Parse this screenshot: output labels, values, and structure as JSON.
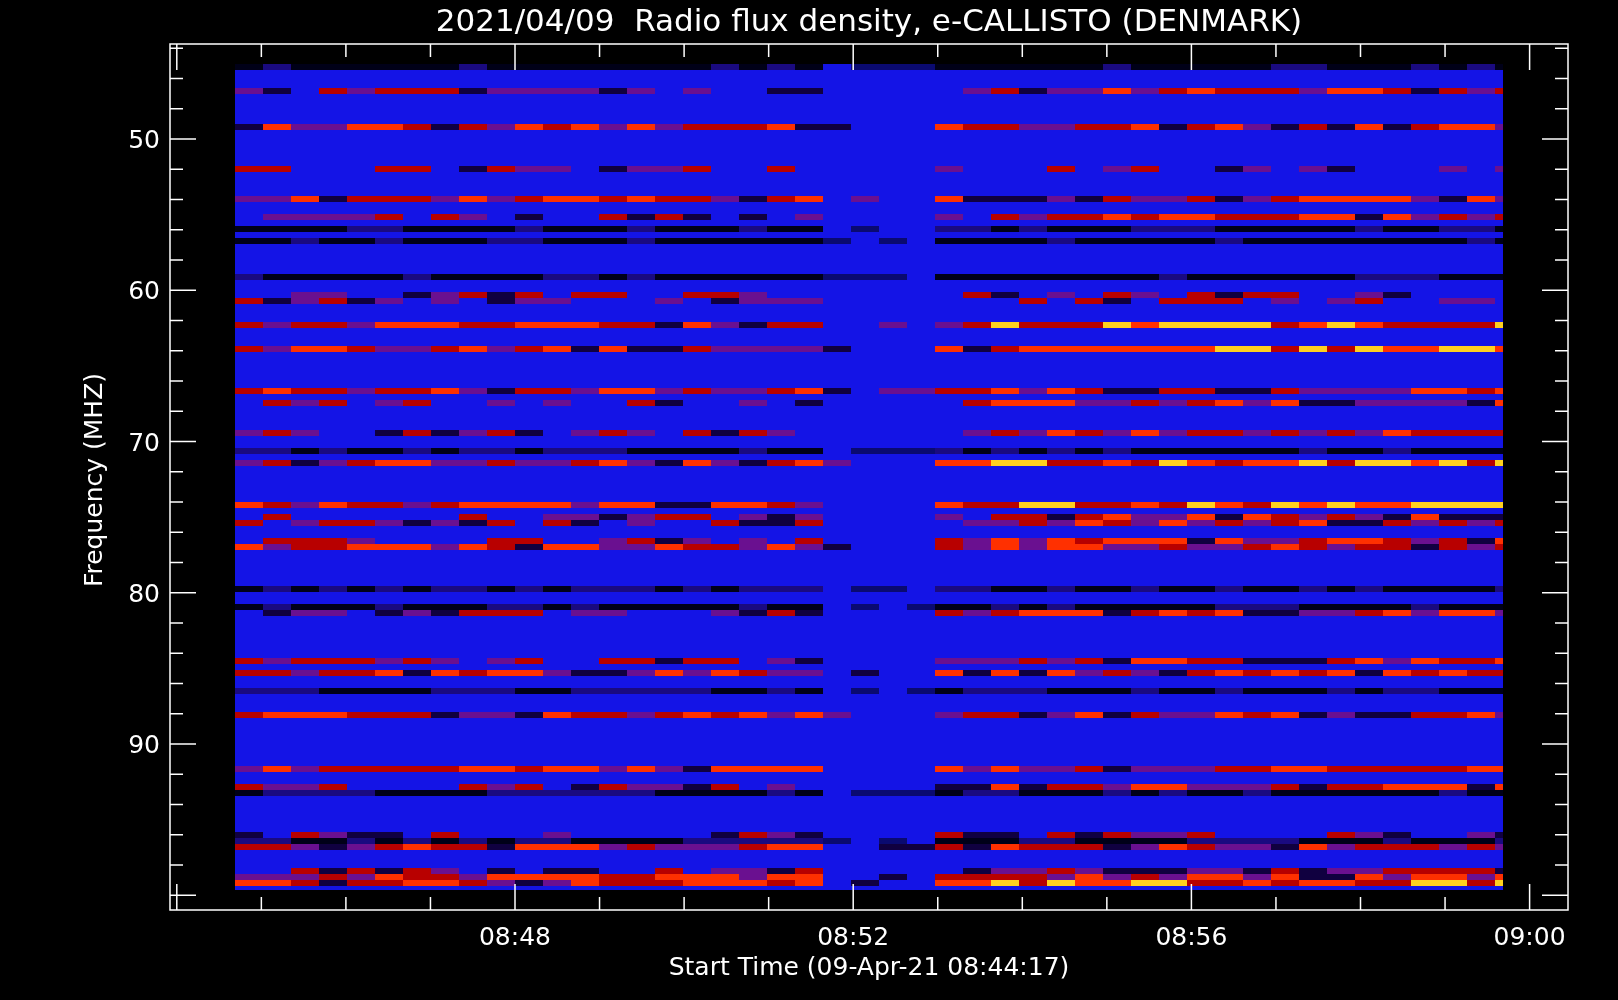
{
  "title": "2021/04/09  Radio flux density, e-CALLISTO (DENMARK)",
  "y_axis": {
    "label": "Frequency (MHZ)",
    "ticks": [
      "50",
      "60",
      "70",
      "80",
      "90"
    ]
  },
  "x_axis": {
    "label": "Start Time (09-Apr-21 08:44:17)",
    "ticks": [
      "08:48",
      "08:52",
      "08:56",
      "09:00"
    ]
  }
}
